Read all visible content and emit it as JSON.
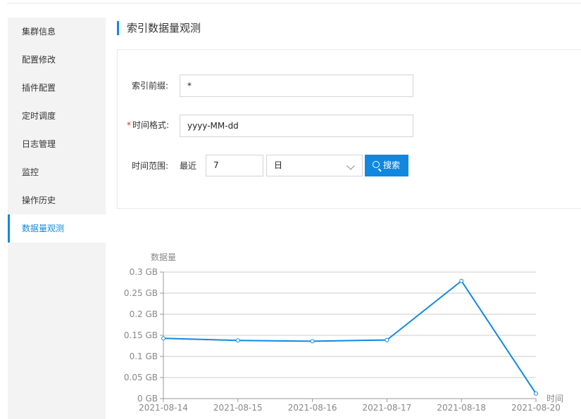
{
  "sidebar": {
    "items": [
      {
        "label": "集群信息"
      },
      {
        "label": "配置修改"
      },
      {
        "label": "插件配置"
      },
      {
        "label": "定时调度"
      },
      {
        "label": "日志管理"
      },
      {
        "label": "监控"
      },
      {
        "label": "操作历史"
      },
      {
        "label": "数据量观测"
      }
    ],
    "active_index": 7
  },
  "page": {
    "title": "索引数据量观测"
  },
  "form": {
    "prefix_label": "索引前缀:",
    "prefix_value": "*",
    "required_mark": "*",
    "time_format_label": "时间格式:",
    "time_format_value": "yyyy-MM-dd",
    "range_label": "时间范围:",
    "recent_label": "最近",
    "range_value": "7",
    "unit_value": "日",
    "search_label": "搜索"
  },
  "colors": {
    "accent": "#1188e0"
  },
  "chart_data": {
    "type": "line",
    "ylabel": "数据量",
    "xlabel": "时间",
    "x": [
      "2021-08-14",
      "2021-08-15",
      "2021-08-16",
      "2021-08-17",
      "2021-08-18",
      "2021-08-20"
    ],
    "series": [
      {
        "values": [
          0.143,
          0.138,
          0.136,
          0.139,
          0.279,
          0.012
        ]
      }
    ],
    "yticks": [
      "0 GB",
      "0.05 GB",
      "0.1 GB",
      "0.15 GB",
      "0.2 GB",
      "0.25 GB",
      "0.3 GB"
    ],
    "ylim": [
      0,
      0.3
    ],
    "unit": "GB",
    "grid": true
  }
}
